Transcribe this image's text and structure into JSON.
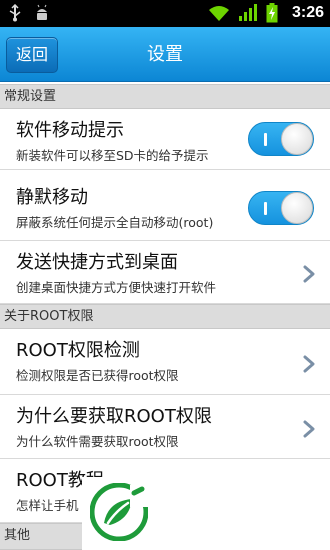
{
  "statusbar": {
    "time": "3:26",
    "icons": [
      "usb-icon",
      "android-debug-icon",
      "wifi-icon",
      "signal-icon",
      "battery-charging-icon"
    ]
  },
  "header": {
    "back_label": "返回",
    "title": "设置"
  },
  "sections": [
    {
      "title": "常规设置",
      "items": [
        {
          "title": "软件移动提示",
          "subtitle": "新装软件可以移至SD卡的给予提示",
          "control": "toggle",
          "on": true
        },
        {
          "title": "静默移动",
          "subtitle": "屏蔽系统任何提示全自动移动(root)",
          "control": "toggle",
          "on": true
        },
        {
          "title": "发送快捷方式到桌面",
          "subtitle": "创建桌面快捷方式方便快速打开软件",
          "control": "chevron"
        }
      ]
    },
    {
      "title": "关于ROOT权限",
      "items": [
        {
          "title": "ROOT权限检测",
          "subtitle": "检测权限是否已获得root权限",
          "control": "chevron"
        },
        {
          "title": "为什么要获取ROOT权限",
          "subtitle": "为什么软件需要获取root权限",
          "control": "chevron"
        },
        {
          "title": "ROOT教程",
          "subtitle": "怎样让手机",
          "control": "chevron"
        }
      ]
    },
    {
      "title": "其他",
      "items": []
    }
  ],
  "colors": {
    "accent": "#1592de",
    "titlebar_top": "#35b4f4",
    "titlebar_bottom": "#0c86d4",
    "logo_green": "#1e9b3a"
  }
}
